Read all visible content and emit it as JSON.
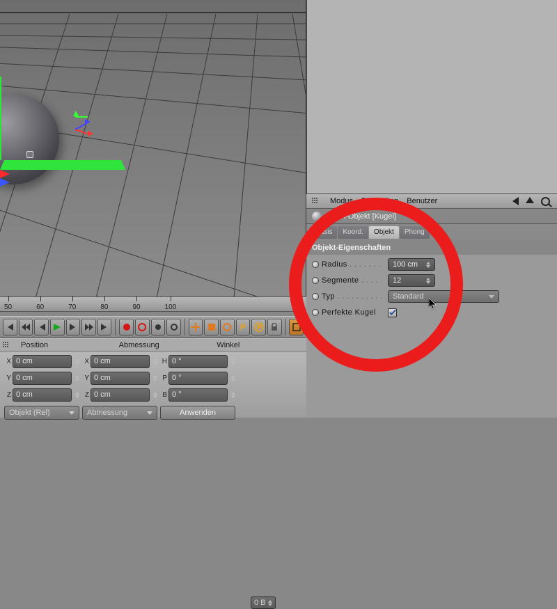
{
  "ruler": {
    "ticks": [
      "50",
      "60",
      "70",
      "80",
      "90",
      "100"
    ],
    "frame_input": "0 B"
  },
  "toolbar": {
    "icons": [
      "go-start-icon",
      "prev-key-icon",
      "prev-frame-icon",
      "play-icon",
      "next-frame-icon",
      "next-key-icon",
      "go-end-icon",
      "record-icon",
      "autokey-icon",
      "keyframe-icon",
      "key-options-icon",
      "move-tool-icon",
      "scale-tool-icon",
      "rotate-tool-icon",
      "p-icon",
      "circle-p-icon",
      "lock-icon",
      "snap-icon"
    ]
  },
  "coord": {
    "headers": {
      "position": "Position",
      "size": "Abmessung",
      "angle": "Winkel"
    },
    "rows": {
      "x": {
        "pos": "0 cm",
        "size": "0 cm",
        "angle": "0 °",
        "angle_label": "H"
      },
      "y": {
        "pos": "0 cm",
        "size": "0 cm",
        "angle": "0 °",
        "angle_label": "P"
      },
      "z": {
        "pos": "0 cm",
        "size": "0 cm",
        "angle": "0 °",
        "angle_label": "B"
      }
    },
    "mode_left": "Objekt (Rel)",
    "mode_mid": "Abmessung",
    "apply": "Anwenden"
  },
  "attr_header": {
    "modus": "Modus",
    "bearbeiten": "Bearbeiten",
    "benutzer": "Benutzer"
  },
  "object_title": "Kugel-Objekt [Kugel]",
  "tabs": {
    "basis": "Basis",
    "koord": "Koord.",
    "objekt": "Objekt",
    "phong": "Phong"
  },
  "section": "Objekt-Eigenschaften",
  "props": {
    "radius_label": "Radius",
    "radius_value": "100 cm",
    "segments_label": "Segmente",
    "segments_value": "12",
    "type_label": "Typ",
    "type_value": "Standard",
    "perfect_label": "Perfekte Kugel",
    "perfect_checked": true
  }
}
